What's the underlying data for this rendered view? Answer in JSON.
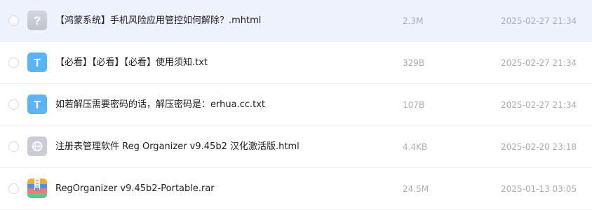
{
  "files": [
    {
      "name": "【鸿蒙系统】手机风险应用管控如何解除？.mhtml",
      "size": "2.3M",
      "date": "2025-02-27 21:34",
      "icon": "unknown-file-icon",
      "selected": true
    },
    {
      "name": "【必看】【必看】【必看】使用须知.txt",
      "size": "329B",
      "date": "2025-02-27 21:34",
      "icon": "text-file-icon",
      "icon_letter": "T",
      "selected": false
    },
    {
      "name": "如若解压需要密码的话，解压密码是：erhua.cc.txt",
      "size": "107B",
      "date": "2025-02-27 21:34",
      "icon": "text-file-icon",
      "icon_letter": "T",
      "selected": false
    },
    {
      "name": "注册表管理软件 Reg Organizer v9.45b2 汉化激活版.html",
      "size": "4.4KB",
      "date": "2025-02-20 23:18",
      "icon": "web-file-icon",
      "selected": false
    },
    {
      "name": "RegOrganizer v9.45b2-Portable.rar",
      "size": "24.5M",
      "date": "2025-01-13 03:05",
      "icon": "archive-file-icon",
      "selected": false
    }
  ],
  "colors": {
    "selected_row_bg": "#eef2fd",
    "text_icon_bg": "#5ab3f3",
    "unknown_icon_bg": "#c9ccd4",
    "web_icon_bg": "#c9ccd4",
    "meta_text": "#a7abb3"
  }
}
